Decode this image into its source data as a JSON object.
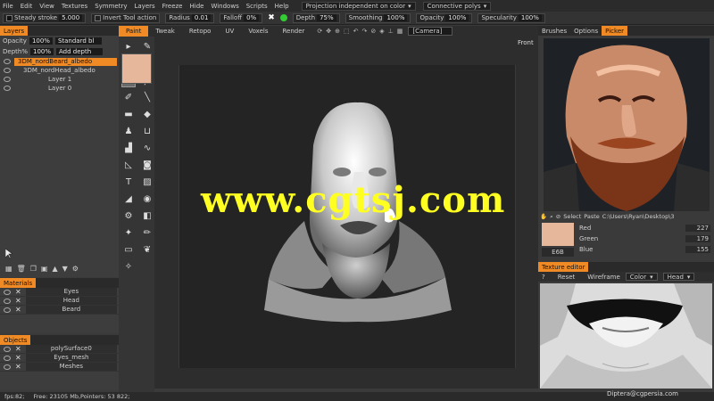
{
  "menubar": {
    "items": [
      "File",
      "Edit",
      "View",
      "Textures",
      "Symmetry",
      "Layers",
      "Freeze",
      "Hide",
      "Windows",
      "Scripts",
      "Help"
    ],
    "projection_mode": "Projection independent on color",
    "connective": "Connective polys"
  },
  "toolbar": {
    "steady_label": "Steady stroke",
    "steady_value": "5.000",
    "invert_label": "Invert Tool action",
    "radius_label": "Radius",
    "radius_value": "0.01",
    "falloff_label": "Falloff",
    "falloff_value": "0%",
    "depth_label": "Depth",
    "depth_value": "75%",
    "smoothing_label": "Smoothing",
    "smoothing_value": "100%",
    "opacity_label": "Opacity",
    "opacity_value": "100%",
    "specularity_label": "Specularity",
    "specularity_value": "100%"
  },
  "rooms": {
    "tabs": [
      "Paint",
      "Tweak",
      "Retopo",
      "UV",
      "Voxels",
      "Render"
    ],
    "camera": "[Camera]"
  },
  "layers_panel": {
    "title": "Layers",
    "opacity_label": "Opacity",
    "opacity_value": "100%",
    "blend_mode": "Standard bl",
    "depth_label": "Depth%",
    "depth_value": "100%",
    "depth_mode": "Add depth",
    "layers": [
      "3DM_nordBeard_albedo",
      "3DM_nordHead_albedo",
      "Layer 1",
      "Layer 0"
    ]
  },
  "materials_panel": {
    "title": "Materials",
    "items": [
      "Eyes",
      "Head",
      "Beard"
    ]
  },
  "objects_panel": {
    "title": "Objects",
    "items": [
      "polySurface0",
      "Eyes_mesh",
      "Meshes"
    ]
  },
  "right_panel": {
    "tabs": [
      "Brushes",
      "Options",
      "Picker"
    ],
    "select_label": "Select",
    "paste_label": "Paste",
    "path": "C:\\Users\\Ryan\\Desktop\\3",
    "color_hex": "#E6B79B",
    "rgb_labels": [
      "Red",
      "Green",
      "Blue"
    ],
    "rgb_values": [
      "227",
      "179",
      "155"
    ],
    "hex_code": "E6B"
  },
  "texture_editor": {
    "title": "Texture editor",
    "help": "?",
    "reset": "Reset",
    "wireframe": "Wireframe",
    "color": "Color",
    "head": "Head"
  },
  "viewport": {
    "view_label": "Front",
    "watermark": "www.cgtsj.com"
  },
  "status": {
    "fps": "fps:82;",
    "free": "Free: 23105 Mb,Pointers: 53 822;",
    "credit": "Diptera@cgpersia.com"
  },
  "colors": {
    "accent": "#F08A24",
    "watermark": "#FFFF22",
    "panel_bg": "#3A3A3A"
  }
}
